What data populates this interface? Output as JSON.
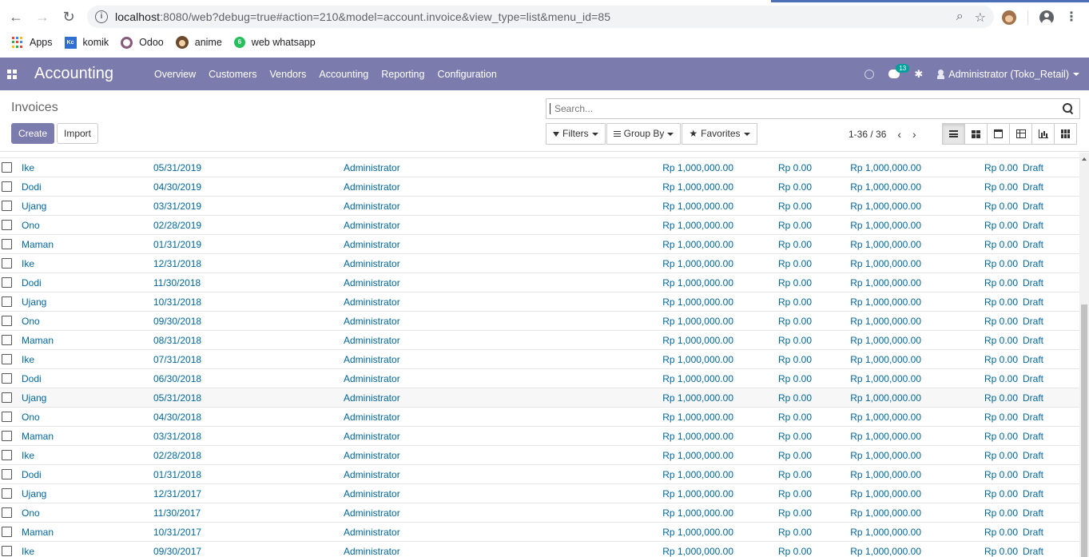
{
  "browser": {
    "url_host": "localhost",
    "url_rest": ":8080/web?debug=true#action=210&model=account.invoice&view_type=list&menu_id=85",
    "bookmarks": [
      {
        "label": "Apps",
        "icon": "apps-grid-icon"
      },
      {
        "label": "komik",
        "icon": "kc-icon"
      },
      {
        "label": "Odoo",
        "icon": "odoo-icon"
      },
      {
        "label": "anime",
        "icon": "anime-icon"
      },
      {
        "label": "web whatsapp",
        "icon": "whatsapp-icon"
      }
    ]
  },
  "navbar": {
    "app_name": "Accounting",
    "menu": [
      "Overview",
      "Customers",
      "Vendors",
      "Accounting",
      "Reporting",
      "Configuration"
    ],
    "messages_count": "13",
    "user": "Administrator (Toko_Retail)",
    "color": "#7c7bad"
  },
  "control": {
    "title": "Invoices",
    "create_label": "Create",
    "import_label": "Import",
    "search_placeholder": "Search...",
    "filters_label": "Filters",
    "groupby_label": "Group By",
    "favorites_label": "Favorites",
    "pager": "1-36 / 36"
  },
  "rows": [
    {
      "customer": "Ike",
      "date": "05/31/2019",
      "salesperson": "Administrator",
      "total": "Rp 1,000,000.00",
      "tax": "Rp 0.00",
      "total2": "Rp 1,000,000.00",
      "due": "Rp 0.00",
      "status": "Draft"
    },
    {
      "customer": "Dodi",
      "date": "04/30/2019",
      "salesperson": "Administrator",
      "total": "Rp 1,000,000.00",
      "tax": "Rp 0.00",
      "total2": "Rp 1,000,000.00",
      "due": "Rp 0.00",
      "status": "Draft"
    },
    {
      "customer": "Ujang",
      "date": "03/31/2019",
      "salesperson": "Administrator",
      "total": "Rp 1,000,000.00",
      "tax": "Rp 0.00",
      "total2": "Rp 1,000,000.00",
      "due": "Rp 0.00",
      "status": "Draft"
    },
    {
      "customer": "Ono",
      "date": "02/28/2019",
      "salesperson": "Administrator",
      "total": "Rp 1,000,000.00",
      "tax": "Rp 0.00",
      "total2": "Rp 1,000,000.00",
      "due": "Rp 0.00",
      "status": "Draft"
    },
    {
      "customer": "Maman",
      "date": "01/31/2019",
      "salesperson": "Administrator",
      "total": "Rp 1,000,000.00",
      "tax": "Rp 0.00",
      "total2": "Rp 1,000,000.00",
      "due": "Rp 0.00",
      "status": "Draft"
    },
    {
      "customer": "Ike",
      "date": "12/31/2018",
      "salesperson": "Administrator",
      "total": "Rp 1,000,000.00",
      "tax": "Rp 0.00",
      "total2": "Rp 1,000,000.00",
      "due": "Rp 0.00",
      "status": "Draft"
    },
    {
      "customer": "Dodi",
      "date": "11/30/2018",
      "salesperson": "Administrator",
      "total": "Rp 1,000,000.00",
      "tax": "Rp 0.00",
      "total2": "Rp 1,000,000.00",
      "due": "Rp 0.00",
      "status": "Draft"
    },
    {
      "customer": "Ujang",
      "date": "10/31/2018",
      "salesperson": "Administrator",
      "total": "Rp 1,000,000.00",
      "tax": "Rp 0.00",
      "total2": "Rp 1,000,000.00",
      "due": "Rp 0.00",
      "status": "Draft"
    },
    {
      "customer": "Ono",
      "date": "09/30/2018",
      "salesperson": "Administrator",
      "total": "Rp 1,000,000.00",
      "tax": "Rp 0.00",
      "total2": "Rp 1,000,000.00",
      "due": "Rp 0.00",
      "status": "Draft"
    },
    {
      "customer": "Maman",
      "date": "08/31/2018",
      "salesperson": "Administrator",
      "total": "Rp 1,000,000.00",
      "tax": "Rp 0.00",
      "total2": "Rp 1,000,000.00",
      "due": "Rp 0.00",
      "status": "Draft"
    },
    {
      "customer": "Ike",
      "date": "07/31/2018",
      "salesperson": "Administrator",
      "total": "Rp 1,000,000.00",
      "tax": "Rp 0.00",
      "total2": "Rp 1,000,000.00",
      "due": "Rp 0.00",
      "status": "Draft"
    },
    {
      "customer": "Dodi",
      "date": "06/30/2018",
      "salesperson": "Administrator",
      "total": "Rp 1,000,000.00",
      "tax": "Rp 0.00",
      "total2": "Rp 1,000,000.00",
      "due": "Rp 0.00",
      "status": "Draft"
    },
    {
      "customer": "Ujang",
      "date": "05/31/2018",
      "salesperson": "Administrator",
      "total": "Rp 1,000,000.00",
      "tax": "Rp 0.00",
      "total2": "Rp 1,000,000.00",
      "due": "Rp 0.00",
      "status": "Draft"
    },
    {
      "customer": "Ono",
      "date": "04/30/2018",
      "salesperson": "Administrator",
      "total": "Rp 1,000,000.00",
      "tax": "Rp 0.00",
      "total2": "Rp 1,000,000.00",
      "due": "Rp 0.00",
      "status": "Draft"
    },
    {
      "customer": "Maman",
      "date": "03/31/2018",
      "salesperson": "Administrator",
      "total": "Rp 1,000,000.00",
      "tax": "Rp 0.00",
      "total2": "Rp 1,000,000.00",
      "due": "Rp 0.00",
      "status": "Draft"
    },
    {
      "customer": "Ike",
      "date": "02/28/2018",
      "salesperson": "Administrator",
      "total": "Rp 1,000,000.00",
      "tax": "Rp 0.00",
      "total2": "Rp 1,000,000.00",
      "due": "Rp 0.00",
      "status": "Draft"
    },
    {
      "customer": "Dodi",
      "date": "01/31/2018",
      "salesperson": "Administrator",
      "total": "Rp 1,000,000.00",
      "tax": "Rp 0.00",
      "total2": "Rp 1,000,000.00",
      "due": "Rp 0.00",
      "status": "Draft"
    },
    {
      "customer": "Ujang",
      "date": "12/31/2017",
      "salesperson": "Administrator",
      "total": "Rp 1,000,000.00",
      "tax": "Rp 0.00",
      "total2": "Rp 1,000,000.00",
      "due": "Rp 0.00",
      "status": "Draft"
    },
    {
      "customer": "Ono",
      "date": "11/30/2017",
      "salesperson": "Administrator",
      "total": "Rp 1,000,000.00",
      "tax": "Rp 0.00",
      "total2": "Rp 1,000,000.00",
      "due": "Rp 0.00",
      "status": "Draft"
    },
    {
      "customer": "Maman",
      "date": "10/31/2017",
      "salesperson": "Administrator",
      "total": "Rp 1,000,000.00",
      "tax": "Rp 0.00",
      "total2": "Rp 1,000,000.00",
      "due": "Rp 0.00",
      "status": "Draft"
    },
    {
      "customer": "Ike",
      "date": "09/30/2017",
      "salesperson": "Administrator",
      "total": "Rp 1,000,000.00",
      "tax": "Rp 0.00",
      "total2": "Rp 1,000,000.00",
      "due": "Rp 0.00",
      "status": "Draft"
    }
  ],
  "highlighted_row_index": 12
}
